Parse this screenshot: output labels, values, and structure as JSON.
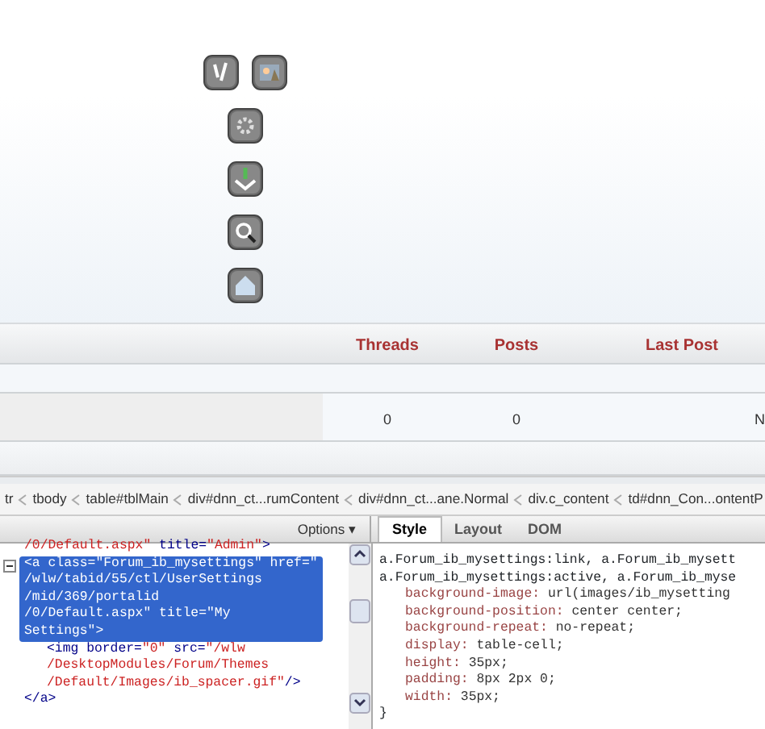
{
  "forum_table": {
    "columns": [
      "Threads",
      "Posts",
      "Last Post"
    ],
    "rows": [
      {
        "threads": "0",
        "posts": "0",
        "last_post": "N"
      }
    ]
  },
  "firebug": {
    "breadcrumbs": [
      "tr",
      "tbody",
      "table#tblMain",
      "div#dnn_ct...rumContent",
      "div#dnn_ct...ane.Normal",
      "div.c_content",
      "td#dnn_Con...ontentP"
    ],
    "options_menu": "Options ▾",
    "html_nodes": [
      {
        "selected": false,
        "lines": [
          [
            {
              "kind": "value",
              "text": "/0/Default.aspx\""
            },
            {
              "kind": "tag",
              "text": " title="
            },
            {
              "kind": "value",
              "text": "\"Admin\""
            },
            {
              "kind": "tag",
              "text": ">"
            }
          ]
        ]
      },
      {
        "selected": true,
        "expanded": true,
        "lines": [
          [
            {
              "kind": "tag",
              "text": "<a class=\"Forum_ib_mysettings\" href=\""
            }
          ],
          [
            {
              "kind": "tag",
              "text": "/wlw/tabid/55/ctl/UserSettings"
            }
          ],
          [
            {
              "kind": "tag",
              "text": "/mid/369/portalid"
            }
          ],
          [
            {
              "kind": "tag",
              "text": "/0/Default.aspx\" title=\"My"
            }
          ],
          [
            {
              "kind": "tag",
              "text": "Settings\">"
            }
          ]
        ],
        "children": [
          {
            "selected": false,
            "lines": [
              [
                {
                  "kind": "tag",
                  "text": "<img border="
                },
                {
                  "kind": "value",
                  "text": "\"0\""
                },
                {
                  "kind": "tag",
                  "text": " src="
                },
                {
                  "kind": "value",
                  "text": "\"/wlw"
                }
              ],
              [
                {
                  "kind": "value",
                  "text": "/DesktopModules/Forum/Themes"
                }
              ],
              [
                {
                  "kind": "value",
                  "text": "/Default/Images/ib_spacer.gif\""
                },
                {
                  "kind": "tag",
                  "text": "/>"
                }
              ]
            ]
          }
        ]
      },
      {
        "selected": false,
        "lines": [
          [
            {
              "kind": "tag",
              "text": "</a>"
            }
          ]
        ]
      }
    ],
    "side_tabs": [
      {
        "label": "Style",
        "selected": true
      },
      {
        "label": "Layout",
        "selected": false
      },
      {
        "label": "DOM",
        "selected": false
      }
    ],
    "css_rule": {
      "selectors": [
        "a.Forum_ib_mysettings:link, a.Forum_ib_mysett",
        "a.Forum_ib_mysettings:active, a.Forum_ib_myse"
      ],
      "declarations": [
        {
          "property": "background-image:",
          "value": "url(images/ib_mysetting"
        },
        {
          "property": "background-position:",
          "value": "center center;"
        },
        {
          "property": "background-repeat:",
          "value": "no-repeat;"
        },
        {
          "property": "display:",
          "value": "table-cell;"
        },
        {
          "property": "height:",
          "value": "35px;"
        },
        {
          "property": "padding:",
          "value": "8px 2px 0;"
        },
        {
          "property": "width:",
          "value": "35px;"
        }
      ],
      "close": "}"
    }
  }
}
